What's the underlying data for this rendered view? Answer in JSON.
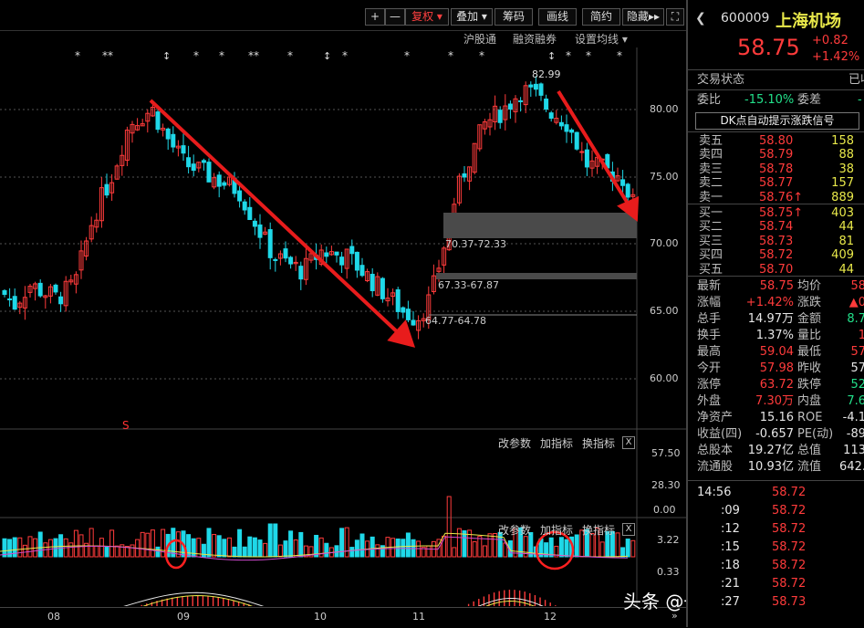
{
  "toolbar": {
    "plus": "+",
    "minus": "—",
    "fuquan": "复权",
    "diejia": "叠加",
    "chouma": "筹码",
    "huaxian": "画线",
    "jianyue": "简约",
    "yincang": "隐藏"
  },
  "subbar": {
    "hugutong": "沪股通",
    "rongzi": "融资融券",
    "junxian": "设置均线"
  },
  "price_axis": [
    "80.00",
    "75.00",
    "70.00",
    "65.00",
    "60.00"
  ],
  "annotations": {
    "high": "82.99",
    "gap1": "70.37-72.33",
    "gap2": "67.33-67.87",
    "gap3": "64.77-64.78",
    "s_mark": "S"
  },
  "vol_panel": {
    "params": "改参数",
    "add": "加指标",
    "switch": "换指标",
    "close": "X",
    "axis": [
      "57.50",
      "28.30",
      "0.00"
    ]
  },
  "macd_panel": {
    "params": "改参数",
    "add": "加指标",
    "switch": "换指标",
    "close": "X",
    "axis": [
      "3.22",
      "0.33"
    ]
  },
  "x_axis": [
    "08",
    "09",
    "10",
    "11",
    "12"
  ],
  "watermark": "头条 @一根K线定乾坤",
  "stock": {
    "code": "600009",
    "name": "上海机场",
    "price": "58.75",
    "change": "+0.82",
    "pct": "+1.42%",
    "trade_status_label": "交易状态",
    "trade_status_value": "已收",
    "weibi_label": "委比",
    "weibi_value": "-15.10%",
    "weicha_label": "委差",
    "weicha_value": "-",
    "dk_banner": "DK点自动提示涨跌信号"
  },
  "sell": [
    {
      "label": "卖五",
      "price": "58.80",
      "vol": "158"
    },
    {
      "label": "卖四",
      "price": "58.79",
      "vol": "88"
    },
    {
      "label": "卖三",
      "price": "58.78",
      "vol": "38"
    },
    {
      "label": "卖二",
      "price": "58.77",
      "vol": "157"
    },
    {
      "label": "卖一",
      "price": "58.76↑",
      "vol": "889"
    }
  ],
  "buy": [
    {
      "label": "买一",
      "price": "58.75↑",
      "vol": "403"
    },
    {
      "label": "买二",
      "price": "58.74",
      "vol": "44"
    },
    {
      "label": "买三",
      "price": "58.73",
      "vol": "81"
    },
    {
      "label": "买四",
      "price": "58.72",
      "vol": "409"
    },
    {
      "label": "买五",
      "price": "58.70",
      "vol": "44"
    }
  ],
  "quotes": [
    {
      "l1": "最新",
      "v1": "58.75",
      "c1": "red",
      "l2": "均价",
      "v2": "58",
      "c2": "red"
    },
    {
      "l1": "涨幅",
      "v1": "+1.42%",
      "c1": "red",
      "l2": "涨跌",
      "v2": "▲0",
      "c2": "red"
    },
    {
      "l1": "总手",
      "v1": "14.97万",
      "c1": "white",
      "l2": "金额",
      "v2": "8.7",
      "c2": "green"
    },
    {
      "l1": "换手",
      "v1": "1.37%",
      "c1": "white",
      "l2": "量比",
      "v2": "1",
      "c2": "red"
    },
    {
      "l1": "最高",
      "v1": "59.04",
      "c1": "red",
      "l2": "最低",
      "v2": "57",
      "c2": "red"
    },
    {
      "l1": "今开",
      "v1": "57.98",
      "c1": "red",
      "l2": "昨收",
      "v2": "57",
      "c2": "white"
    },
    {
      "l1": "涨停",
      "v1": "63.72",
      "c1": "red",
      "l2": "跌停",
      "v2": "52",
      "c2": "green"
    },
    {
      "l1": "外盘",
      "v1": "7.30万",
      "c1": "red",
      "l2": "内盘",
      "v2": "7.6",
      "c2": "green"
    },
    {
      "l1": "净资产",
      "v1": "15.16",
      "c1": "white",
      "l2": "ROE",
      "v2": "-4.1",
      "c2": "white"
    },
    {
      "l1": "收益(四)",
      "v1": "-0.657",
      "c1": "white",
      "l2": "PE(动)",
      "v2": "-89",
      "c2": "white"
    },
    {
      "l1": "总股本",
      "v1": "19.27亿",
      "c1": "white",
      "l2": "总值",
      "v2": "113",
      "c2": "white"
    },
    {
      "l1": "流通股",
      "v1": "10.93亿",
      "c1": "white",
      "l2": "流值",
      "v2": "642.",
      "c2": "white"
    }
  ],
  "ticks": [
    {
      "t": "14:56",
      "p": "58.72"
    },
    {
      "t": ":09",
      "p": "58.72"
    },
    {
      "t": ":12",
      "p": "58.72"
    },
    {
      "t": ":15",
      "p": "58.72"
    },
    {
      "t": ":18",
      "p": "58.72"
    },
    {
      "t": ":21",
      "p": "58.72"
    },
    {
      "t": ":27",
      "p": "58.73"
    }
  ]
}
